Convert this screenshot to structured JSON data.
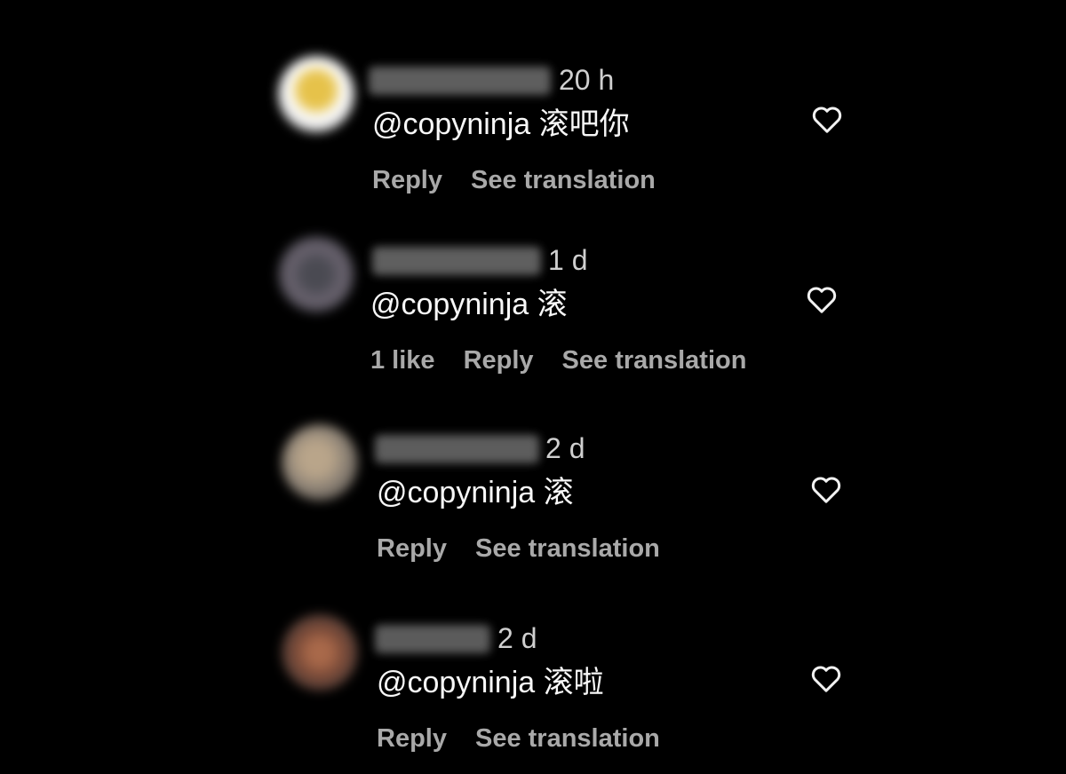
{
  "colors": {
    "background": "#000000",
    "text": "#f7f7f7",
    "muted": "#a9a9a9",
    "time": "#cfcfcf"
  },
  "comments": [
    {
      "time": "20 h",
      "text": "@copyninja 滚吧你",
      "likes": "",
      "reply_label": "Reply",
      "translate_label": "See translation",
      "icon": "heart-outline-icon"
    },
    {
      "time": "1 d",
      "text": "@copyninja 滚",
      "likes": "1 like",
      "reply_label": "Reply",
      "translate_label": "See translation",
      "icon": "heart-outline-icon"
    },
    {
      "time": "2 d",
      "text": "@copyninja 滚",
      "likes": "",
      "reply_label": "Reply",
      "translate_label": "See translation",
      "icon": "heart-outline-icon"
    },
    {
      "time": "2 d",
      "text": "@copyninja 滚啦",
      "likes": "",
      "reply_label": "Reply",
      "translate_label": "See translation",
      "icon": "heart-outline-icon"
    }
  ]
}
